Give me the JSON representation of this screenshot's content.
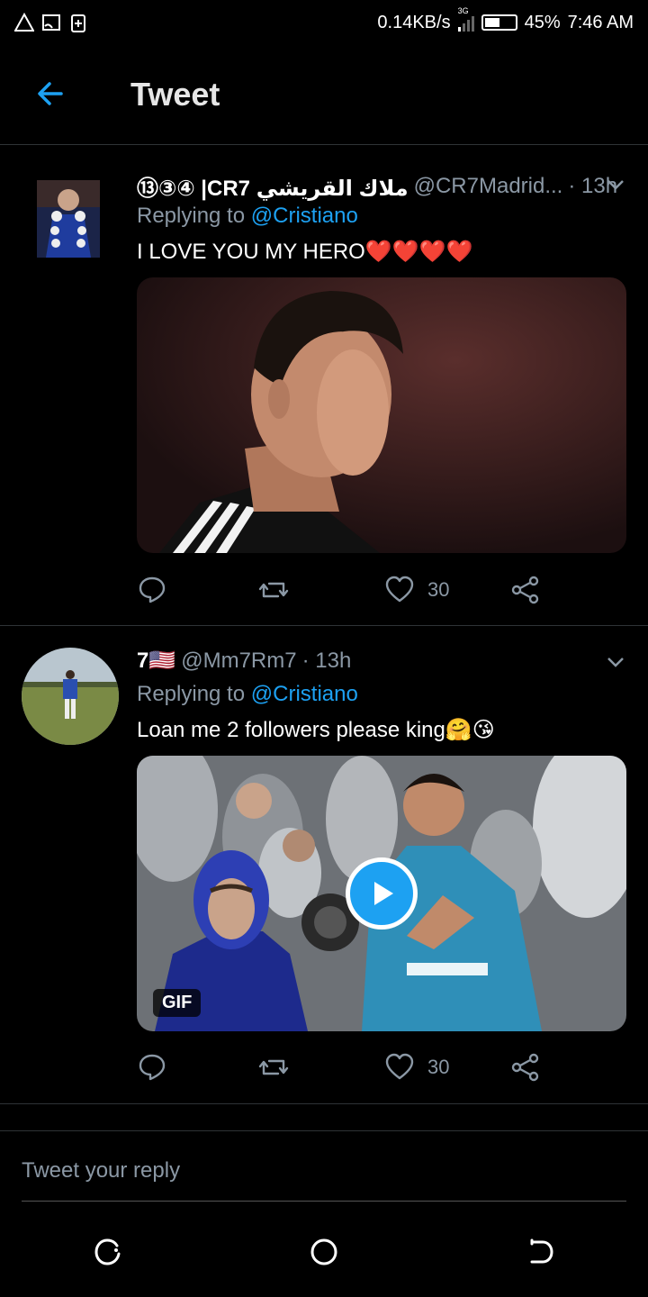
{
  "status_bar": {
    "network_speed": "0.14KB/s",
    "network_type": "3G",
    "battery": "45%",
    "battery_level": 0.45,
    "time": "7:46 AM",
    "left_icons": [
      "warning-triangle-icon",
      "cast-icon",
      "battery-saver-icon"
    ]
  },
  "header": {
    "title": "Tweet"
  },
  "tweets": [
    {
      "display_name": "⑬③④ |CR7 ملاك القريشي",
      "handle": "@CR7Madrid...",
      "time": "· 13h",
      "replying_prefix": "Replying to",
      "replying_to": "@Cristiano",
      "text": "I LOVE YOU MY HERO❤️❤️❤️❤️",
      "media_type": "image",
      "like_count": "30"
    },
    {
      "display_name": "7🇺🇸",
      "handle": "@Mm7Rm7",
      "time": "· 13h",
      "replying_prefix": "Replying to",
      "replying_to": "@Cristiano",
      "text": "Loan me 2 followers please king🤗😘",
      "media_type": "gif",
      "media_badge": "GIF",
      "like_count": "30"
    }
  ],
  "reply_bar": {
    "placeholder": "Tweet your reply"
  },
  "colors": {
    "accent": "#1da1f2",
    "background": "#000000",
    "secondary_text": "#8b98a5"
  }
}
